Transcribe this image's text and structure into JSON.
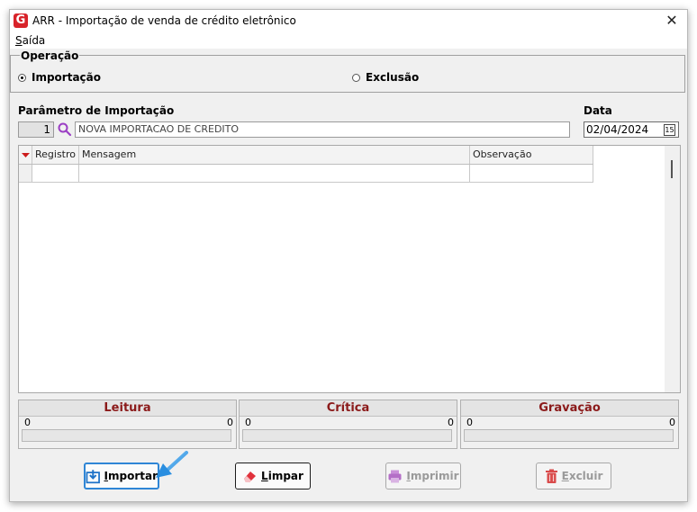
{
  "window": {
    "title": "ARR - Importação de venda de crédito eletrônico",
    "app_icon_letter": "G"
  },
  "menu": {
    "exit_first": "S",
    "exit_rest": "aída"
  },
  "operation": {
    "group_title": "Operação",
    "options": [
      {
        "label": "Importação",
        "selected": true
      },
      {
        "label": "Exclusão",
        "selected": false
      }
    ]
  },
  "import_param": {
    "label": "Parâmetro de Importação",
    "code": "1",
    "description": "NOVA IMPORTACAO DE CREDITO"
  },
  "date": {
    "label": "Data",
    "value": "02/04/2024",
    "calendar_icon_text": "15"
  },
  "grid": {
    "columns": [
      "Registro",
      "Mensagem",
      "Observação"
    ]
  },
  "panels": [
    {
      "title": "Leitura",
      "left": "0",
      "right": "0"
    },
    {
      "title": "Crítica",
      "left": "0",
      "right": "0"
    },
    {
      "title": "Gravação",
      "left": "0",
      "right": "0"
    }
  ],
  "buttons": {
    "import": {
      "first": "I",
      "rest": "mportar"
    },
    "clear": {
      "first": "L",
      "rest": "impar"
    },
    "print": {
      "first": "I",
      "rest": "mprimir"
    },
    "delete": {
      "first": "E",
      "rest": "xcluir"
    }
  },
  "colors": {
    "panel_title": "#8b1a1a",
    "focus_border": "#2f86d6",
    "app_icon": "#d8232a"
  }
}
